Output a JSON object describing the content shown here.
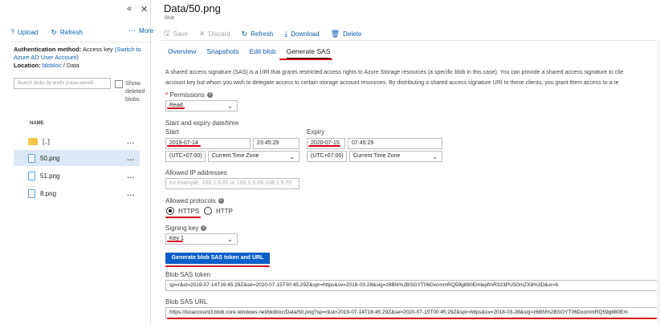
{
  "left": {
    "collapse_glyph": "«",
    "close_glyph": "✕",
    "toolbar": {
      "upload_icon": "⤒",
      "upload_label": "Upload",
      "refresh_icon": "↻",
      "refresh_label": "Refresh",
      "more_icon": "···",
      "more_label": "More"
    },
    "auth": {
      "method_label": "Authentication method:",
      "method_value": "Access key",
      "switch_link": "(Switch to Azure AD User Account)",
      "location_label": "Location:",
      "location_link": "blobloc",
      "location_rest": "/ Data"
    },
    "search_placeholder": "Search blobs by prefix (case-sensiti...",
    "show_deleted_label": "Show deleted blobs",
    "column_header": "NAME",
    "files": [
      {
        "name": "[..]",
        "more": "...",
        "type": "folder"
      },
      {
        "name": "50.png",
        "more": "...",
        "type": "file"
      },
      {
        "name": "51.png",
        "more": "...",
        "type": "file"
      },
      {
        "name": "8.png",
        "more": "...",
        "type": "file"
      }
    ]
  },
  "right": {
    "title": "Data/50.png",
    "subtitle": "Blob",
    "close_glyph": "✕",
    "toolbar": {
      "save_icon": "🖫",
      "save_label": "Save",
      "discard_icon": "✕",
      "discard_label": "Discard",
      "refresh_icon": "↻",
      "refresh_label": "Refresh",
      "download_icon": "⤓",
      "download_label": "Download",
      "delete_icon": "🗑",
      "delete_label": "Delete"
    },
    "tabs": [
      "Overview",
      "Snapshots",
      "Edit blob",
      "Generate SAS"
    ],
    "description_line1": "A shared access signature (SAS) is a URI that grants restricted access rights to Azure Storage resources (a specific blob in this case). You can provide a shared access signature to clie",
    "description_line2": "account key but whom you wish to delegate access to certain storage account resources. By distributing a shared access signature URI to these clients, you grant them access to a re",
    "permissions_label": "Permissions",
    "permissions_value": "Read",
    "date_label": "Start and expiry date/time",
    "start_label": "Start",
    "start_date": "2019-07-14",
    "start_time": "23:45:29",
    "start_tz_offset": "(UTC+07:00)",
    "start_tz_name": "Current Time Zone",
    "expiry_label": "Expiry",
    "expiry_date": "2020-07-15",
    "expiry_time": "07:45:29",
    "expiry_tz_offset": "(UTC+07:00)",
    "expiry_tz_name": "Current Time Zone",
    "ip_label": "Allowed IP addresses",
    "ip_placeholder": "for example, 168.1.5.65 or 168.1.5.65-168.1.5.70",
    "protocols_label": "Allowed protocols",
    "protocol_https": "HTTPS",
    "protocol_http": "HTTP",
    "protocol_selected": "HTTPS",
    "signing_key_label": "Signing key",
    "signing_key_value": "Key 1",
    "generate_button": "Generate blob SAS token and URL",
    "sas_token_label": "Blob SAS token",
    "sas_token_value": "sp=r&st=2019-07-14T16:45:29Z&se=2020-07-15T00:45:29Z&spr=https&sv=2018-03-28&sig=z6BN%2BSGYT06DxcmmRQ59g880EmlepfmR323PUS0mZX8%3D&sr=b",
    "sas_url_label": "Blob SAS URL",
    "sas_url_value": "https://locaccount3.blob.core.windows.net/blobloc/Data/50.png?sp=r&st=2019-07-14T16:45:29Z&se=2020-07-15T00:45:29Z&spr=https&sv=2018-03-28&sig=z6BN%2BSGYT06DxcmmRQ59g880Em"
  },
  "colors": {
    "accent": "#0b5cad",
    "button": "#0a5fc9",
    "annotation": "#d4001a",
    "selected_row": "#dce8f5"
  }
}
